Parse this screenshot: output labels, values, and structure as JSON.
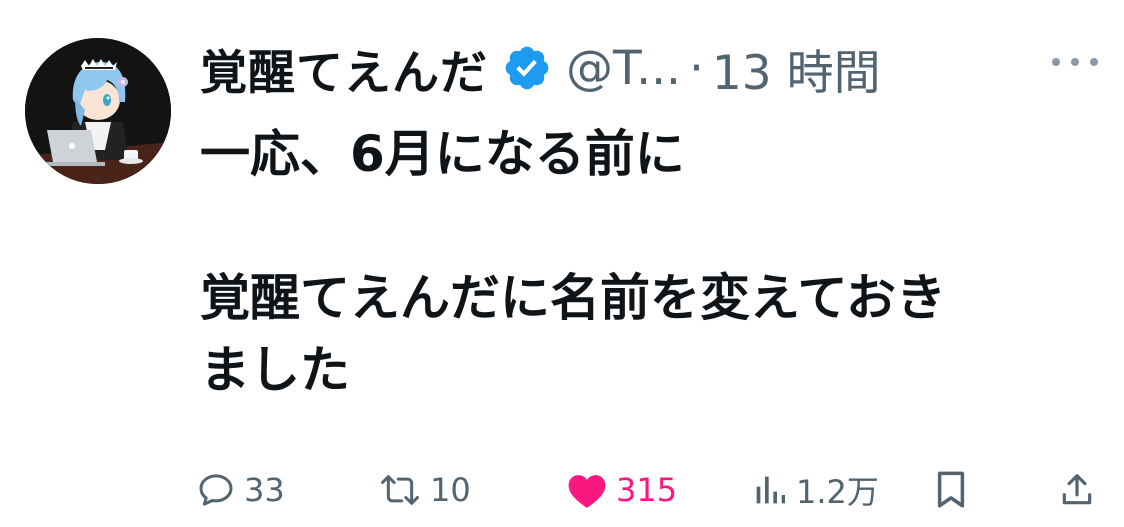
{
  "tweet": {
    "display_name": "覚醒てえんだ",
    "handle": "@T...",
    "separator": "·",
    "time": "13 時間",
    "text_line_1": "一応、6月になる前に",
    "text_line_2": "覚醒てえんだに名前を変えておき",
    "text_line_3": "ました",
    "verified_icon": "verified-badge-icon",
    "more_icon": "more-icon"
  },
  "actions": {
    "reply": {
      "icon": "reply-icon",
      "count": "33"
    },
    "retweet": {
      "icon": "retweet-icon",
      "count": "10"
    },
    "like": {
      "icon": "heart-icon",
      "count": "315",
      "liked": true
    },
    "views": {
      "icon": "analytics-icon",
      "count": "1.2万"
    },
    "bookmark": {
      "icon": "bookmark-icon"
    },
    "share": {
      "icon": "share-icon"
    }
  },
  "colors": {
    "text_primary": "#0f1419",
    "text_secondary": "#536471",
    "verified_blue": "#1d9bf0",
    "like_pink": "#f91880"
  }
}
